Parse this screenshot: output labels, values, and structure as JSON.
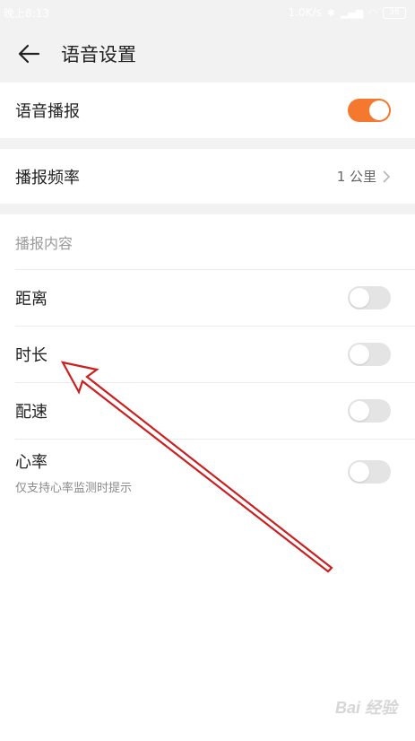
{
  "status_bar": {
    "time": "晚上8:13",
    "speed": "1.0K/s",
    "battery": "38"
  },
  "header": {
    "title": "语音设置"
  },
  "voice_broadcast": {
    "label": "语音播报",
    "enabled": true
  },
  "frequency": {
    "label": "播报频率",
    "value": "1 公里"
  },
  "content": {
    "section_label": "播报内容",
    "items": [
      {
        "label": "距离",
        "enabled": false
      },
      {
        "label": "时长",
        "enabled": false
      },
      {
        "label": "配速",
        "enabled": false
      },
      {
        "label": "心率",
        "sublabel": "仅支持心率监测时提示",
        "enabled": false
      }
    ]
  },
  "colors": {
    "accent": "#f5782f",
    "annotation_arrow": "#cc1f1f"
  },
  "watermark": "Bai 经验"
}
